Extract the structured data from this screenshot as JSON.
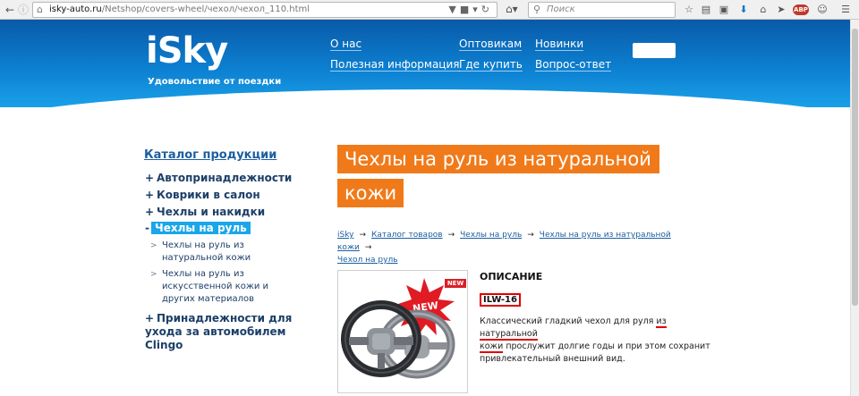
{
  "browser": {
    "url_host": "isky-auto.ru",
    "url_path": "/Netshop/covers-wheel/чехол/чехол_110.html",
    "search_placeholder": "Поиск",
    "abp_label": "ABP"
  },
  "header": {
    "logo": "iSky",
    "tagline": "Удовольствие от поездки",
    "nav": [
      {
        "label": "О нас"
      },
      {
        "label": "Полезная информация"
      },
      {
        "label": "Оптовикам"
      },
      {
        "label": "Где купить"
      },
      {
        "label": "Новинки"
      },
      {
        "label": "Вопрос-ответ"
      }
    ]
  },
  "sidebar": {
    "title": "Каталог продукции",
    "items": [
      {
        "bullet": "+",
        "label": "Автопринадлежности"
      },
      {
        "bullet": "+",
        "label": "Коврики в салон"
      },
      {
        "bullet": "+",
        "label": "Чехлы и накидки"
      },
      {
        "bullet": "-",
        "label": "Чехлы на руль"
      }
    ],
    "subitems": [
      {
        "arrow": ">",
        "lines": [
          "Чехлы на руль из",
          "натуральной кожи"
        ]
      },
      {
        "arrow": ">",
        "lines": [
          "Чехлы на руль из",
          "искусственной кожи и",
          "других материалов"
        ]
      }
    ],
    "last_item": {
      "bullet": "+",
      "lines": [
        "Принадлежности для",
        "ухода за автомобилем",
        "Clingo"
      ]
    }
  },
  "main": {
    "title_lines": [
      "Чехлы на руль из натуральной",
      "кожи"
    ],
    "breadcrumb": [
      "iSky",
      "Каталог товаров",
      "Чехлы на руль",
      "Чехлы на руль из натуральной кожи",
      "Чехол на руль"
    ],
    "breadcrumb_sep": "→",
    "badge": "NEW",
    "starburst": "NEW",
    "description_heading": "ОПИСАНИЕ",
    "sku": "ILW-16",
    "description": {
      "before": "Классический гладкий чехол для руля ",
      "highlight1": "из натуральной",
      "highlight2": "кожи",
      "after": " прослужит долгие годы и при этом сохранит привлекательный внешний вид."
    }
  },
  "colors": {
    "header_blue": "#0c7fd0",
    "title_orange": "#f07a1a",
    "active_cyan": "#1aa6e8",
    "annotation_red": "#e00000"
  }
}
